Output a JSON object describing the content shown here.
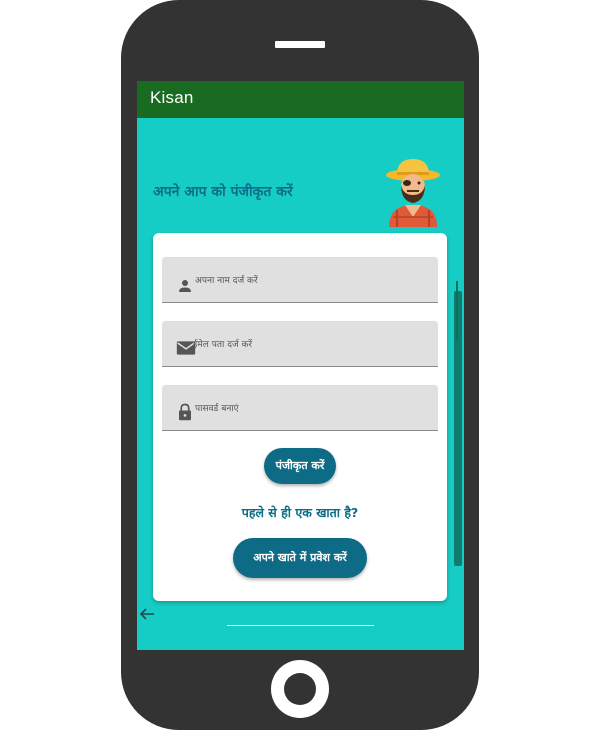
{
  "app": {
    "title": "Kisan"
  },
  "screen": {
    "heading": "अपने आप को पंजीकृत करें"
  },
  "form": {
    "name_placeholder": "अपना नाम दर्ज करें",
    "email_placeholder": "ईमेल पता दर्ज करें",
    "password_placeholder": "पासवर्ड बनाएं",
    "register_label": "पंजीकृत करें",
    "account_prompt": "पहले से ही एक खाता है?",
    "login_label": "अपने खाते में प्रवेश करें"
  },
  "icons": {
    "name_field": "person-icon",
    "email_field": "mail-icon",
    "password_field": "lock-icon",
    "farmer": "farmer-avatar",
    "back": "back-arrow-icon"
  },
  "colors": {
    "app_bar": "#1a6b22",
    "screen_bg": "#16cdc5",
    "accent": "#0e6b85",
    "phone_body": "#333333"
  }
}
